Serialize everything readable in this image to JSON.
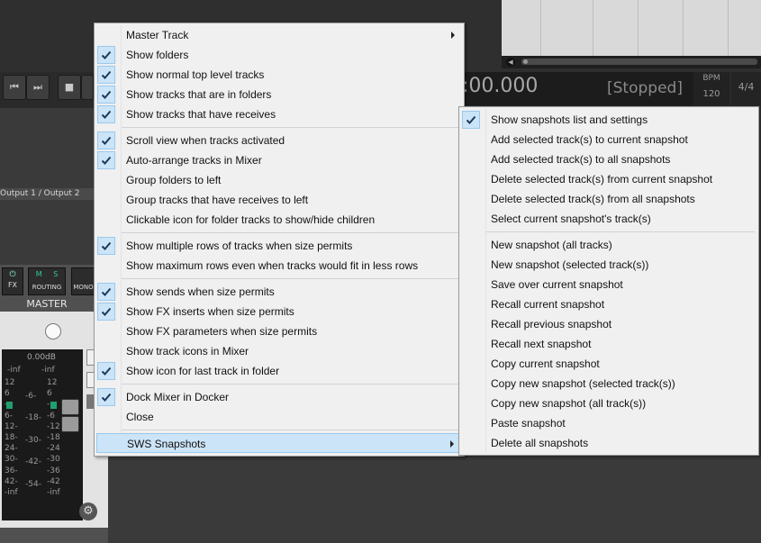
{
  "transport": {
    "time": ":00.000",
    "status": "[Stopped]",
    "bpm_label": "BPM",
    "bpm_value": "120",
    "time_signature": "4/4"
  },
  "track_panel": {
    "output_label": "Output 1 / Output 2"
  },
  "mixer": {
    "master_label": "MASTER",
    "fx_button": "FX",
    "routing_button": "ROUTING",
    "mono_button": "MONO",
    "ms_buttons": [
      "M",
      "S"
    ],
    "volume_readout": "0.00dB",
    "meter_peak_left": "-inf",
    "meter_peak_right": "-inf",
    "scale_left": [
      "12",
      "6",
      "-",
      "6-",
      "12-",
      "18-",
      "24-",
      "30-",
      "36-",
      "42-",
      "-inf"
    ],
    "scale_mid": [
      "-6-",
      "-18-",
      "-30-",
      "-42-",
      "-54-"
    ],
    "scale_right": [
      "12",
      "6",
      "-",
      "-6",
      "-12",
      "-18",
      "-24",
      "-30",
      "-36",
      "-42",
      "-inf"
    ]
  },
  "main_menu": {
    "items": [
      {
        "label": "Master Track",
        "checked": false,
        "submenu": true
      },
      {
        "label": "Show folders",
        "checked": true
      },
      {
        "label": "Show normal top level tracks",
        "checked": true
      },
      {
        "label": "Show tracks that are in folders",
        "checked": true
      },
      {
        "label": "Show tracks that have receives",
        "checked": true
      },
      {
        "label": "Scroll view when tracks activated",
        "checked": true
      },
      {
        "label": "Auto-arrange tracks in Mixer",
        "checked": true
      },
      {
        "label": "Group folders to left",
        "checked": false
      },
      {
        "label": "Group tracks that have receives to left",
        "checked": false
      },
      {
        "label": "Clickable icon for folder tracks to show/hide children",
        "checked": false
      },
      {
        "label": "Show multiple rows of tracks when size permits",
        "checked": true
      },
      {
        "label": "Show maximum rows even when tracks would fit in less rows",
        "checked": false
      },
      {
        "label": "Show sends when size permits",
        "checked": true
      },
      {
        "label": "Show FX inserts when size permits",
        "checked": true
      },
      {
        "label": "Show FX parameters when size permits",
        "checked": false
      },
      {
        "label": "Show track icons in Mixer",
        "checked": false
      },
      {
        "label": "Show icon for last track in folder",
        "checked": true
      },
      {
        "label": "Dock Mixer in Docker",
        "checked": true
      },
      {
        "label": "Close",
        "checked": false
      },
      {
        "label": "SWS Snapshots",
        "checked": false,
        "submenu": true,
        "highlighted": true
      }
    ]
  },
  "sub_menu": {
    "items": [
      {
        "label": "Show snapshots list and settings",
        "checked": true
      },
      {
        "label": "Add selected track(s) to current snapshot"
      },
      {
        "label": "Add selected track(s) to all snapshots"
      },
      {
        "label": "Delete selected track(s) from current snapshot"
      },
      {
        "label": "Delete selected track(s) from all snapshots"
      },
      {
        "label": "Select current snapshot's track(s)"
      },
      {
        "label": "New snapshot (all tracks)"
      },
      {
        "label": "New snapshot (selected track(s))"
      },
      {
        "label": "Save over current snapshot"
      },
      {
        "label": "Recall current snapshot"
      },
      {
        "label": "Recall previous snapshot"
      },
      {
        "label": "Recall next snapshot"
      },
      {
        "label": "Copy current snapshot"
      },
      {
        "label": "Copy new snapshot (selected track(s))"
      },
      {
        "label": "Copy new snapshot (all track(s))"
      },
      {
        "label": "Paste snapshot"
      },
      {
        "label": "Delete all snapshots"
      }
    ]
  },
  "icons": {
    "checkmark": "checkmark-icon",
    "submenu_arrow": "chevron-right-icon",
    "gear": "gear-icon",
    "power": "power-icon",
    "skip_back": "skip-back-icon",
    "skip_forward": "skip-forward-icon",
    "stop": "stop-icon"
  },
  "colors": {
    "menu_bg": "#f0f0f0",
    "check_bg": "#cce4f7",
    "check_mark": "#1e3a5a",
    "meter_green": "#1ea06e"
  }
}
